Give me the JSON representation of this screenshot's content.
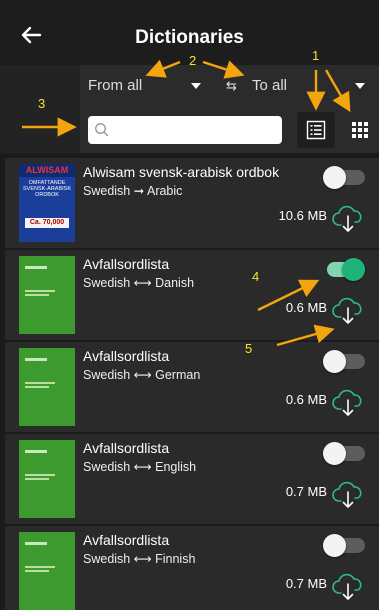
{
  "header": {
    "title": "Dictionaries"
  },
  "filters": {
    "from_label": "From all",
    "to_label": "To all",
    "swap_symbol": "⇆"
  },
  "annotations": [
    "1",
    "2",
    "3",
    "4",
    "5"
  ],
  "cover": {
    "alwisam_title": "ALWISAM",
    "alwisam_subtitle": "OMFATTANDE SVENSK-ARABISK ORDBOK",
    "alwisam_badge": "Ca. 70,000"
  },
  "dictionaries": [
    {
      "name": "Alwisam svensk-arabisk ordbok",
      "pair": "Swedish ➞ Arabic",
      "size": "10.6 MB",
      "enabled": false
    },
    {
      "name": "Avfallsordlista",
      "pair": "Swedish ⟷ Danish",
      "size": "0.6 MB",
      "enabled": true
    },
    {
      "name": "Avfallsordlista",
      "pair": "Swedish ⟷ German",
      "size": "0.6 MB",
      "enabled": false
    },
    {
      "name": "Avfallsordlista",
      "pair": "Swedish ⟷ English",
      "size": "0.7 MB",
      "enabled": false
    },
    {
      "name": "Avfallsordlista",
      "pair": "Swedish ⟷ Finnish",
      "size": "0.7 MB",
      "enabled": false
    }
  ]
}
